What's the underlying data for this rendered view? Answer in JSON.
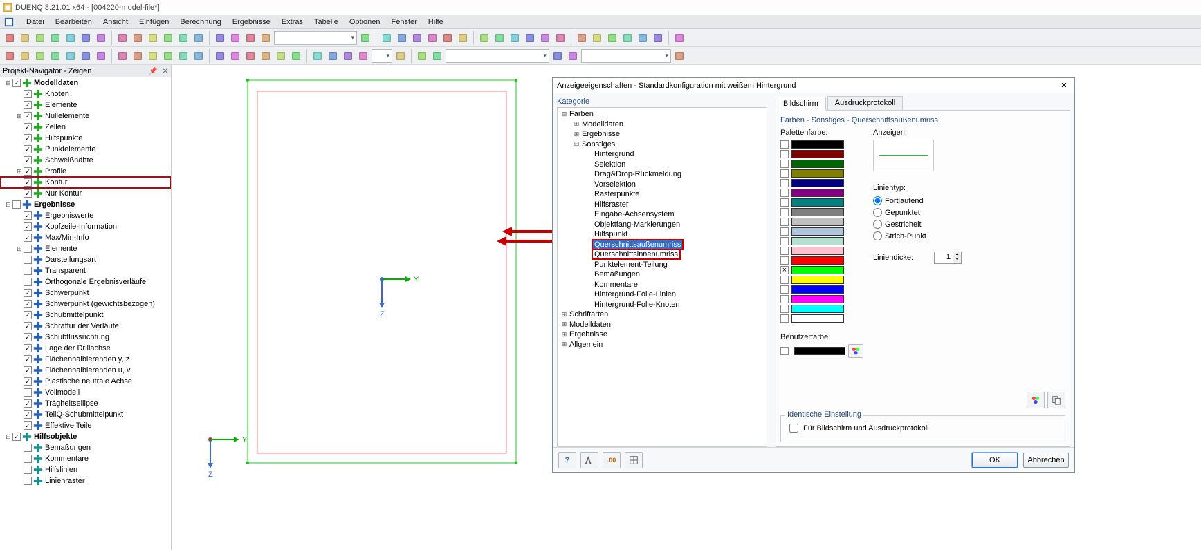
{
  "window": {
    "title": "DUENQ 8.21.01 x64 - [004220-model-file*]"
  },
  "menu": [
    "Datei",
    "Bearbeiten",
    "Ansicht",
    "Einfügen",
    "Berechnung",
    "Ergebnisse",
    "Extras",
    "Tabelle",
    "Optionen",
    "Fenster",
    "Hilfe"
  ],
  "navigator": {
    "title": "Projekt-Navigator - Zeigen",
    "items": [
      {
        "lvl": 0,
        "exp": "-",
        "chk": true,
        "ico": "green",
        "label": "Modelldaten",
        "bold": true
      },
      {
        "lvl": 1,
        "exp": "",
        "chk": true,
        "ico": "green",
        "label": "Knoten"
      },
      {
        "lvl": 1,
        "exp": "",
        "chk": true,
        "ico": "green",
        "label": "Elemente"
      },
      {
        "lvl": 1,
        "exp": "+",
        "chk": true,
        "ico": "green",
        "label": "Nullelemente"
      },
      {
        "lvl": 1,
        "exp": "",
        "chk": true,
        "ico": "green",
        "label": "Zellen"
      },
      {
        "lvl": 1,
        "exp": "",
        "chk": true,
        "ico": "green",
        "label": "Hilfspunkte"
      },
      {
        "lvl": 1,
        "exp": "",
        "chk": true,
        "ico": "green",
        "label": "Punktelemente"
      },
      {
        "lvl": 1,
        "exp": "",
        "chk": true,
        "ico": "green",
        "label": "Schweißnähte"
      },
      {
        "lvl": 1,
        "exp": "+",
        "chk": true,
        "ico": "green",
        "label": "Profile"
      },
      {
        "lvl": 1,
        "exp": "",
        "chk": true,
        "ico": "green",
        "label": "Kontur",
        "hl": true
      },
      {
        "lvl": 1,
        "exp": "",
        "chk": true,
        "ico": "green",
        "label": "Nur Kontur"
      },
      {
        "lvl": 0,
        "exp": "-",
        "chk": false,
        "ico": "blue",
        "label": "Ergebnisse",
        "bold": true
      },
      {
        "lvl": 1,
        "exp": "",
        "chk": true,
        "ico": "blue",
        "label": "Ergebniswerte"
      },
      {
        "lvl": 1,
        "exp": "",
        "chk": true,
        "ico": "blue",
        "label": "Kopfzeile-Information"
      },
      {
        "lvl": 1,
        "exp": "",
        "chk": true,
        "ico": "blue",
        "label": "Max/Min-Info"
      },
      {
        "lvl": 1,
        "exp": "+",
        "chk": false,
        "ico": "blue",
        "label": "Elemente"
      },
      {
        "lvl": 1,
        "exp": "",
        "chk": false,
        "ico": "blue",
        "label": "Darstellungsart"
      },
      {
        "lvl": 1,
        "exp": "",
        "chk": false,
        "ico": "blue",
        "label": "Transparent"
      },
      {
        "lvl": 1,
        "exp": "",
        "chk": false,
        "ico": "blue",
        "label": "Orthogonale Ergebnisverläufe"
      },
      {
        "lvl": 1,
        "exp": "",
        "chk": true,
        "ico": "blue",
        "label": "Schwerpunkt"
      },
      {
        "lvl": 1,
        "exp": "",
        "chk": true,
        "ico": "blue",
        "label": "Schwerpunkt (gewichtsbezogen)"
      },
      {
        "lvl": 1,
        "exp": "",
        "chk": true,
        "ico": "blue",
        "label": "Schubmittelpunkt"
      },
      {
        "lvl": 1,
        "exp": "",
        "chk": true,
        "ico": "blue",
        "label": "Schraffur der Verläufe"
      },
      {
        "lvl": 1,
        "exp": "",
        "chk": true,
        "ico": "blue",
        "label": "Schubflussrichtung"
      },
      {
        "lvl": 1,
        "exp": "",
        "chk": true,
        "ico": "blue",
        "label": "Lage der Drillachse"
      },
      {
        "lvl": 1,
        "exp": "",
        "chk": true,
        "ico": "blue",
        "label": "Flächenhalbierenden y, z"
      },
      {
        "lvl": 1,
        "exp": "",
        "chk": true,
        "ico": "blue",
        "label": "Flächenhalbierenden u, v"
      },
      {
        "lvl": 1,
        "exp": "",
        "chk": true,
        "ico": "blue",
        "label": "Plastische neutrale Achse"
      },
      {
        "lvl": 1,
        "exp": "",
        "chk": false,
        "ico": "blue",
        "label": "Vollmodell"
      },
      {
        "lvl": 1,
        "exp": "",
        "chk": true,
        "ico": "blue",
        "label": "Trägheitsellipse"
      },
      {
        "lvl": 1,
        "exp": "",
        "chk": true,
        "ico": "blue",
        "label": "TeilQ-Schubmittelpunkt"
      },
      {
        "lvl": 1,
        "exp": "",
        "chk": true,
        "ico": "blue",
        "label": "Effektive Teile"
      },
      {
        "lvl": 0,
        "exp": "-",
        "chk": true,
        "ico": "teal",
        "label": "Hilfsobjekte",
        "bold": true
      },
      {
        "lvl": 1,
        "exp": "",
        "chk": false,
        "ico": "teal",
        "label": "Bemaßungen"
      },
      {
        "lvl": 1,
        "exp": "",
        "chk": false,
        "ico": "teal",
        "label": "Kommentare"
      },
      {
        "lvl": 1,
        "exp": "",
        "chk": false,
        "ico": "teal",
        "label": "Hilfslinien"
      },
      {
        "lvl": 1,
        "exp": "",
        "chk": false,
        "ico": "teal",
        "label": "Linienraster"
      }
    ]
  },
  "canvas": {
    "y_label": "Y",
    "z_label": "Z"
  },
  "dialog": {
    "title": "Anzeigeeigenschaften - Standardkonfiguration mit weißem Hintergrund",
    "category_label": "Kategorie",
    "categories": [
      {
        "lvl": 0,
        "exp": "-",
        "label": "Farben"
      },
      {
        "lvl": 1,
        "exp": "+",
        "label": "Modelldaten"
      },
      {
        "lvl": 1,
        "exp": "+",
        "label": "Ergebnisse"
      },
      {
        "lvl": 1,
        "exp": "-",
        "label": "Sonstiges"
      },
      {
        "lvl": 2,
        "exp": "",
        "label": "Hintergrund"
      },
      {
        "lvl": 2,
        "exp": "",
        "label": "Selektion"
      },
      {
        "lvl": 2,
        "exp": "",
        "label": "Drag&Drop-Rückmeldung"
      },
      {
        "lvl": 2,
        "exp": "",
        "label": "Vorselektion"
      },
      {
        "lvl": 2,
        "exp": "",
        "label": "Rasterpunkte"
      },
      {
        "lvl": 2,
        "exp": "",
        "label": "Hilfsraster"
      },
      {
        "lvl": 2,
        "exp": "",
        "label": "Eingabe-Achsensystem"
      },
      {
        "lvl": 2,
        "exp": "",
        "label": "Objektfang-Markierungen"
      },
      {
        "lvl": 2,
        "exp": "",
        "label": "Hilfspunkt"
      },
      {
        "lvl": 2,
        "exp": "",
        "label": "Querschnittsaußenumriss",
        "sel": true,
        "red": true
      },
      {
        "lvl": 2,
        "exp": "",
        "label": "Querschnittsinnenumriss",
        "red": true
      },
      {
        "lvl": 2,
        "exp": "",
        "label": "Punktelement-Teilung"
      },
      {
        "lvl": 2,
        "exp": "",
        "label": "Bemaßungen"
      },
      {
        "lvl": 2,
        "exp": "",
        "label": "Kommentare"
      },
      {
        "lvl": 2,
        "exp": "",
        "label": "Hintergrund-Folie-Linien"
      },
      {
        "lvl": 2,
        "exp": "",
        "label": "Hintergrund-Folie-Knoten"
      },
      {
        "lvl": 0,
        "exp": "+",
        "label": "Schriftarten"
      },
      {
        "lvl": 0,
        "exp": "+",
        "label": "Modelldaten"
      },
      {
        "lvl": 0,
        "exp": "+",
        "label": "Ergebnisse"
      },
      {
        "lvl": 0,
        "exp": "+",
        "label": "Allgemein"
      }
    ],
    "tabs": {
      "screen": "Bildschirm",
      "print": "Ausdruckprotokoll"
    },
    "section_title": "Farben - Sonstiges - Querschnittsaußenumriss",
    "labels": {
      "palette": "Palettenfarbe:",
      "show": "Anzeigen:",
      "linetype": "Linientyp:",
      "lt_cont": "Fortlaufend",
      "lt_dot": "Gepunktet",
      "lt_dash": "Gestrichelt",
      "lt_dashdot": "Strich-Punkt",
      "thickness": "Liniendicke:",
      "thickness_val": "1",
      "usercolor": "Benutzerfarbe:",
      "identical": "Identische Einstellung",
      "identical_chk": "Für Bildschirm und Ausdruckprotokoll",
      "ok": "OK",
      "cancel": "Abbrechen"
    },
    "palette": [
      {
        "c": "#000000"
      },
      {
        "c": "#800000"
      },
      {
        "c": "#006400"
      },
      {
        "c": "#808000"
      },
      {
        "c": "#000080"
      },
      {
        "c": "#800080"
      },
      {
        "c": "#008080"
      },
      {
        "c": "#808080"
      },
      {
        "c": "#c0c0c0"
      },
      {
        "c": "#b0c4de"
      },
      {
        "c": "#b4e0d0"
      },
      {
        "c": "#ffc0cb"
      },
      {
        "c": "#ff0000"
      },
      {
        "c": "#00ff00",
        "on": true
      },
      {
        "c": "#ffff00"
      },
      {
        "c": "#0000ff"
      },
      {
        "c": "#ff00ff"
      },
      {
        "c": "#00ffff"
      },
      {
        "c": "#ffffff"
      }
    ]
  }
}
